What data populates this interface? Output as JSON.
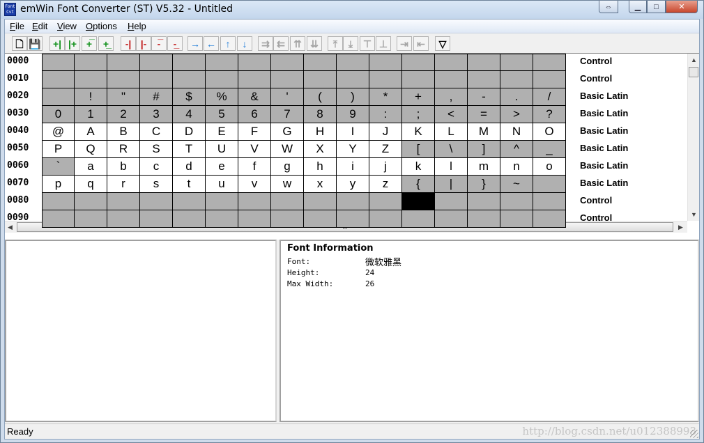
{
  "window": {
    "title": "emWin Font Converter (ST) V5.32 - Untitled",
    "icon_text": "Font Cvt"
  },
  "window_controls": {
    "restore": "⇔",
    "minimize": "▁",
    "maximize": "□",
    "close": "✕"
  },
  "menu": [
    {
      "label": "File",
      "hotkey": "F"
    },
    {
      "label": "Edit",
      "hotkey": "E"
    },
    {
      "label": "View",
      "hotkey": "V"
    },
    {
      "label": "Options",
      "hotkey": "O"
    },
    {
      "label": "Help",
      "hotkey": "H"
    }
  ],
  "toolbar": [
    {
      "name": "new-icon",
      "glyph": "🗋",
      "cls": ""
    },
    {
      "name": "save-icon",
      "glyph": "💾",
      "cls": ""
    },
    {
      "name": "enable-char-left-icon",
      "glyph": "+|",
      "cls": "green"
    },
    {
      "name": "enable-char-right-icon",
      "glyph": "|+",
      "cls": "green"
    },
    {
      "name": "enable-top-icon",
      "glyph": "+̅",
      "cls": "green"
    },
    {
      "name": "enable-bottom-icon",
      "glyph": "+̲",
      "cls": "green"
    },
    {
      "name": "disable-char-left-icon",
      "glyph": "-|",
      "cls": "red"
    },
    {
      "name": "disable-char-right-icon",
      "glyph": "|-",
      "cls": "red"
    },
    {
      "name": "disable-top-icon",
      "glyph": "-̅",
      "cls": "red"
    },
    {
      "name": "disable-bottom-icon",
      "glyph": "-̲",
      "cls": "red"
    },
    {
      "name": "arrow-right-icon",
      "glyph": "→",
      "cls": "blue"
    },
    {
      "name": "arrow-left-icon",
      "glyph": "←",
      "cls": "blue"
    },
    {
      "name": "arrow-up-icon",
      "glyph": "↑",
      "cls": "blue"
    },
    {
      "name": "arrow-down-icon",
      "glyph": "↓",
      "cls": "blue"
    },
    {
      "name": "move-right-icon",
      "glyph": "⇉",
      "cls": "dis"
    },
    {
      "name": "move-left-icon",
      "glyph": "⇇",
      "cls": "dis"
    },
    {
      "name": "move-up-icon",
      "glyph": "⇈",
      "cls": "dis"
    },
    {
      "name": "move-down-icon",
      "glyph": "⇊",
      "cls": "dis"
    },
    {
      "name": "insert-top-icon",
      "glyph": "⤒",
      "cls": "dis"
    },
    {
      "name": "insert-bottom-icon",
      "glyph": "⤓",
      "cls": "dis"
    },
    {
      "name": "delete-top-icon",
      "glyph": "⊤",
      "cls": "dis"
    },
    {
      "name": "delete-bottom-icon",
      "glyph": "⊥",
      "cls": "dis"
    },
    {
      "name": "insert-right-icon",
      "glyph": "⇥",
      "cls": "dis"
    },
    {
      "name": "insert-left-icon",
      "glyph": "⇤",
      "cls": "dis"
    },
    {
      "name": "filter-icon",
      "glyph": "▽",
      "cls": ""
    }
  ],
  "grid": {
    "rows": [
      {
        "code": "0000",
        "block": "Control",
        "chars": [
          "",
          "",
          "",
          "",
          "",
          "",
          "",
          "",
          "",
          "",
          "",
          "",
          "",
          "",
          "",
          ""
        ],
        "state": "gggggggggggggggg"
      },
      {
        "code": "0010",
        "block": "Control",
        "chars": [
          "",
          "",
          "",
          "",
          "",
          "",
          "",
          "",
          "",
          "",
          "",
          "",
          "",
          "",
          "",
          ""
        ],
        "state": "gggggggggggggggg"
      },
      {
        "code": "0020",
        "block": "Basic Latin",
        "chars": [
          "",
          " !",
          "\"",
          "#",
          "$",
          "%",
          "&",
          "'",
          "(",
          ")",
          "*",
          "+",
          ",",
          "-",
          ".",
          "/"
        ],
        "state": "gggggggggggggggg"
      },
      {
        "code": "0030",
        "block": "Basic Latin",
        "chars": [
          "0",
          "1",
          "2",
          "3",
          "4",
          "5",
          "6",
          "7",
          "8",
          "9",
          ":",
          ";",
          "<",
          "=",
          ">",
          "?"
        ],
        "state": "gggggggggggggggg"
      },
      {
        "code": "0040",
        "block": "Basic Latin",
        "chars": [
          "@",
          "A",
          "B",
          "C",
          "D",
          "E",
          "F",
          "G",
          "H",
          "I",
          "J",
          "K",
          "L",
          "M",
          "N",
          "O"
        ],
        "state": "wwwwwwwwwwwwwwww"
      },
      {
        "code": "0050",
        "block": "Basic Latin",
        "chars": [
          "P",
          "Q",
          "R",
          "S",
          "T",
          "U",
          "V",
          "W",
          "X",
          "Y",
          "Z",
          "[",
          "\\",
          "]",
          "^",
          "_"
        ],
        "state": "wwwwwwwwwwwggggg"
      },
      {
        "code": "0060",
        "block": "Basic Latin",
        "chars": [
          "`",
          "a",
          "b",
          "c",
          "d",
          "e",
          "f",
          "g",
          "h",
          "i",
          "j",
          "k",
          "l",
          "m",
          "n",
          "o"
        ],
        "state": "gwwwwwwwwwwwwwww"
      },
      {
        "code": "0070",
        "block": "Basic Latin",
        "chars": [
          "p",
          "q",
          "r",
          "s",
          "t",
          "u",
          "v",
          "w",
          "x",
          "y",
          "z",
          "{",
          "|",
          "}",
          "~",
          ""
        ],
        "state": "wwwwwwwwwwwggggg"
      },
      {
        "code": "0080",
        "block": "Control",
        "chars": [
          "",
          "",
          "",
          "",
          "",
          "",
          "",
          "",
          "",
          "",
          "",
          "",
          "",
          "",
          "",
          ""
        ],
        "state": "gggggggggggkgggg"
      },
      {
        "code": "0090",
        "block": "Control",
        "chars": [
          "",
          "",
          "",
          "",
          "",
          "",
          "",
          "",
          "",
          "",
          "",
          "",
          "",
          "",
          "",
          ""
        ],
        "state": "gggggggggggggggg"
      }
    ]
  },
  "scroll": {
    "up": "▲",
    "down": "▼",
    "left": "◀",
    "right": "▶",
    "grip": "III"
  },
  "font_info": {
    "title": "Font Information",
    "font_label": "Font:",
    "font_value": "微软雅黑",
    "height_label": "Height:",
    "height_value": "24",
    "maxwidth_label": "Max Width:",
    "maxwidth_value": "26"
  },
  "status": {
    "text": "Ready",
    "watermark": "http://blog.csdn.net/u012388993"
  }
}
